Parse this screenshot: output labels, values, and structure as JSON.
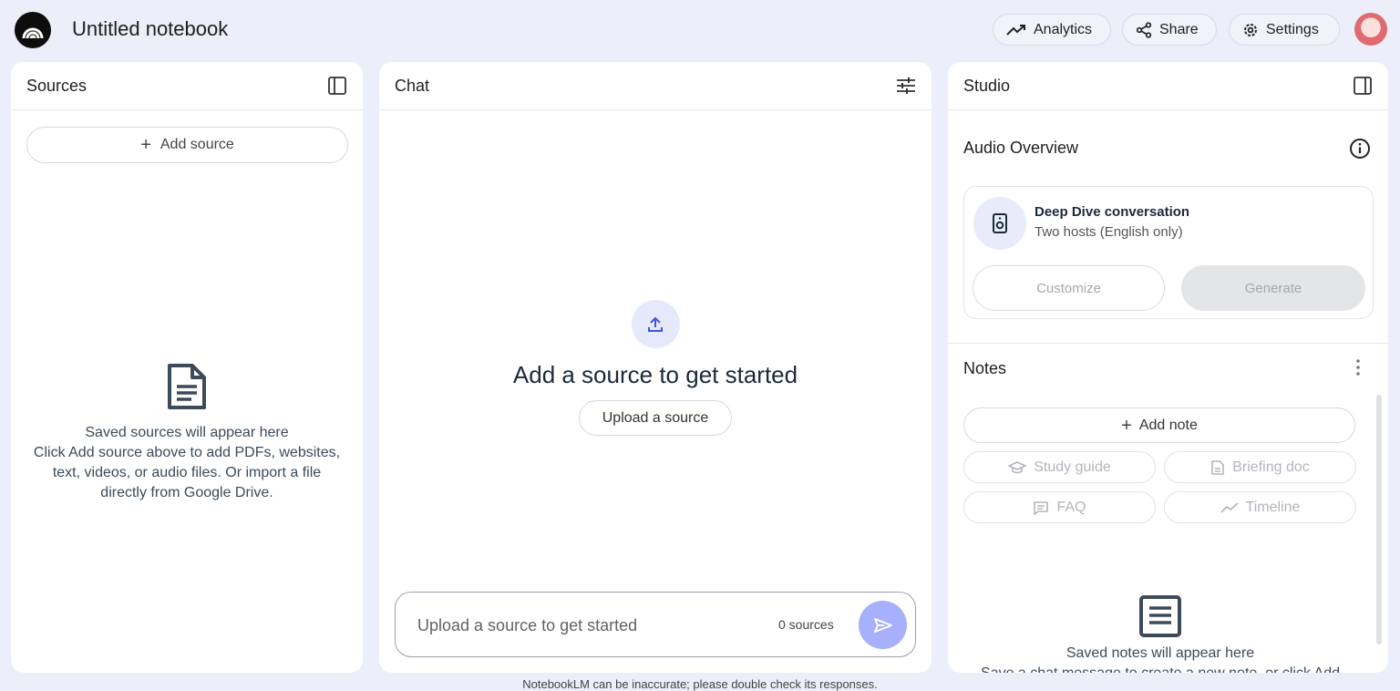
{
  "app": {
    "notebook_title": "Untitled notebook"
  },
  "header": {
    "analytics_label": "Analytics",
    "share_label": "Share",
    "settings_label": "Settings"
  },
  "sources": {
    "title": "Sources",
    "add_source_label": "Add source",
    "empty_title": "Saved sources will appear here",
    "empty_body_1": "Click Add source above to add PDFs, websites,",
    "empty_body_2": "text, videos, or audio files. Or import a file",
    "empty_body_3": "directly from Google Drive."
  },
  "chat": {
    "title": "Chat",
    "heading": "Add a source to get started",
    "upload_label": "Upload a source",
    "input_placeholder": "Upload a source to get started",
    "source_count": "0 sources"
  },
  "studio": {
    "title": "Studio",
    "audio_overview_title": "Audio Overview",
    "deep_dive_title": "Deep Dive conversation",
    "deep_dive_sub": "Two hosts (English only)",
    "customize_label": "Customize",
    "generate_label": "Generate",
    "notes_title": "Notes",
    "add_note_label": "Add note",
    "study_guide_label": "Study guide",
    "briefing_doc_label": "Briefing doc",
    "faq_label": "FAQ",
    "timeline_label": "Timeline",
    "notes_empty_title": "Saved notes will appear here",
    "notes_empty_body": "Save a chat message to create a new note, or click Add"
  },
  "footer": {
    "disclaimer": "NotebookLM can be inaccurate; please double check its responses."
  },
  "colors": {
    "background": "#eceef9",
    "accent": "#a7b0fb",
    "panel": "#ffffff"
  }
}
